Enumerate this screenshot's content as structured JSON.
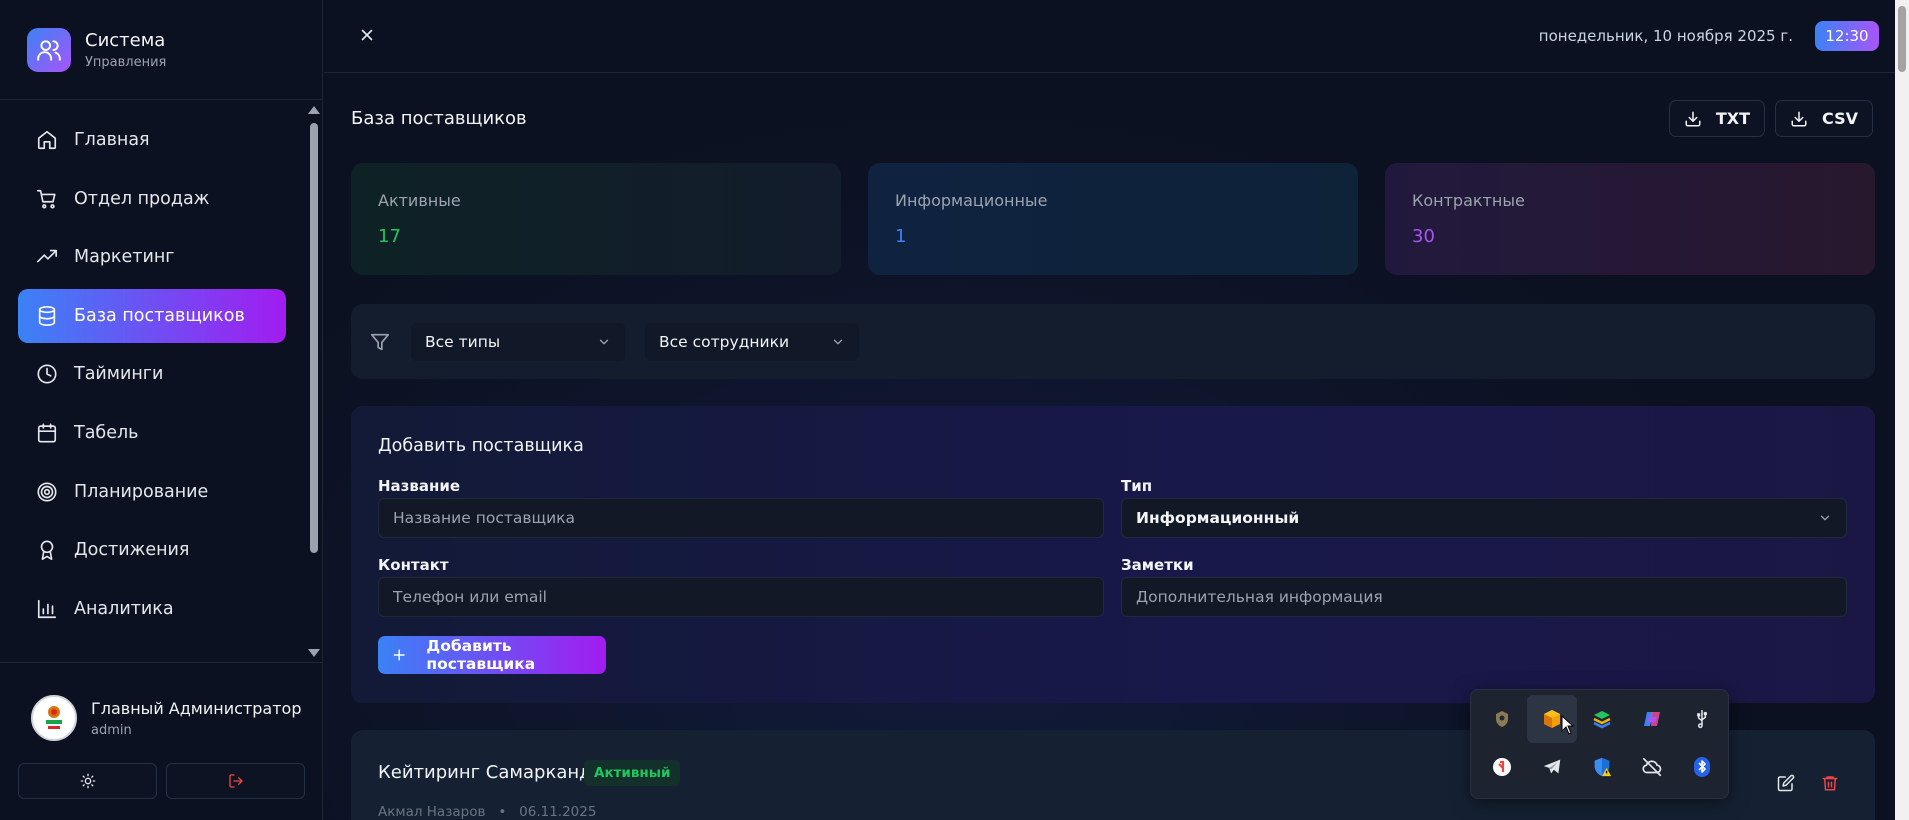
{
  "brand": {
    "title": "Система",
    "subtitle": "Управления"
  },
  "sidebar": {
    "items": [
      {
        "label": "Главная",
        "icon": "home-icon"
      },
      {
        "label": "Отдел продаж",
        "icon": "cart-icon"
      },
      {
        "label": "Маркетинг",
        "icon": "trending-up-icon"
      },
      {
        "label": "База поставщиков",
        "icon": "database-icon",
        "active": true
      },
      {
        "label": "Тайминги",
        "icon": "clock-icon"
      },
      {
        "label": "Табель",
        "icon": "calendar-icon"
      },
      {
        "label": "Планирование",
        "icon": "target-icon"
      },
      {
        "label": "Достижения",
        "icon": "award-icon"
      },
      {
        "label": "Аналитика",
        "icon": "bar-chart-icon"
      }
    ]
  },
  "user": {
    "name": "Главный Администратор",
    "login": "admin"
  },
  "topbar": {
    "date": "понедельник, 10 ноября 2025 г.",
    "time": "12:30"
  },
  "page": {
    "title": "База поставщиков",
    "export": {
      "txt": "TXT",
      "csv": "CSV"
    }
  },
  "stats": [
    {
      "label": "Активные",
      "value": "17",
      "color": "#22c55e"
    },
    {
      "label": "Информационные",
      "value": "1",
      "color": "#3b82f6"
    },
    {
      "label": "Контрактные",
      "value": "30",
      "color": "#a855f7"
    }
  ],
  "filters": {
    "type": "Все типы",
    "employee": "Все сотрудники"
  },
  "form": {
    "title": "Добавить поставщика",
    "name_label": "Название",
    "name_placeholder": "Название поставщика",
    "type_label": "Тип",
    "type_value": "Информационный",
    "contact_label": "Контакт",
    "contact_placeholder": "Телефон или email",
    "notes_label": "Заметки",
    "notes_placeholder": "Дополнительная информация",
    "submit": "Добавить поставщика"
  },
  "supplier": {
    "name": "Кейтиринг Самарканд",
    "status": "Активный",
    "owner": "Акмал Назаров",
    "sep": "•",
    "date": "06.11.2025"
  },
  "colors": {
    "accent_start": "#3b82f6",
    "accent_end": "#a855f7",
    "bg": "#0b1120"
  }
}
